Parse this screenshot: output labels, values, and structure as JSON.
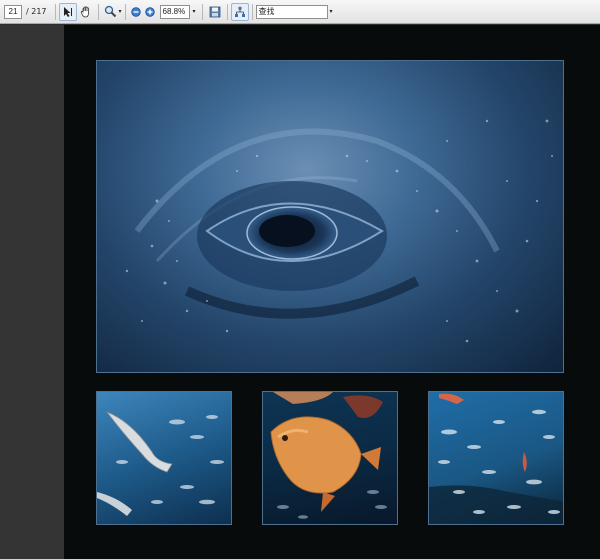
{
  "toolbar": {
    "page_number": "21",
    "page_total": "/ 217",
    "zoom_value": "68.8%",
    "search_value": "查找",
    "icons": [
      "select-text-icon",
      "hand-tool-icon",
      "zoom-tool-icon",
      "zoom-out-icon",
      "zoom-in-icon",
      "save-icon",
      "tree-view-icon"
    ]
  },
  "colors": {
    "page_background": "#070b0c",
    "photo_border": "#4e7090",
    "viewer_background": "#2e2e2e"
  }
}
